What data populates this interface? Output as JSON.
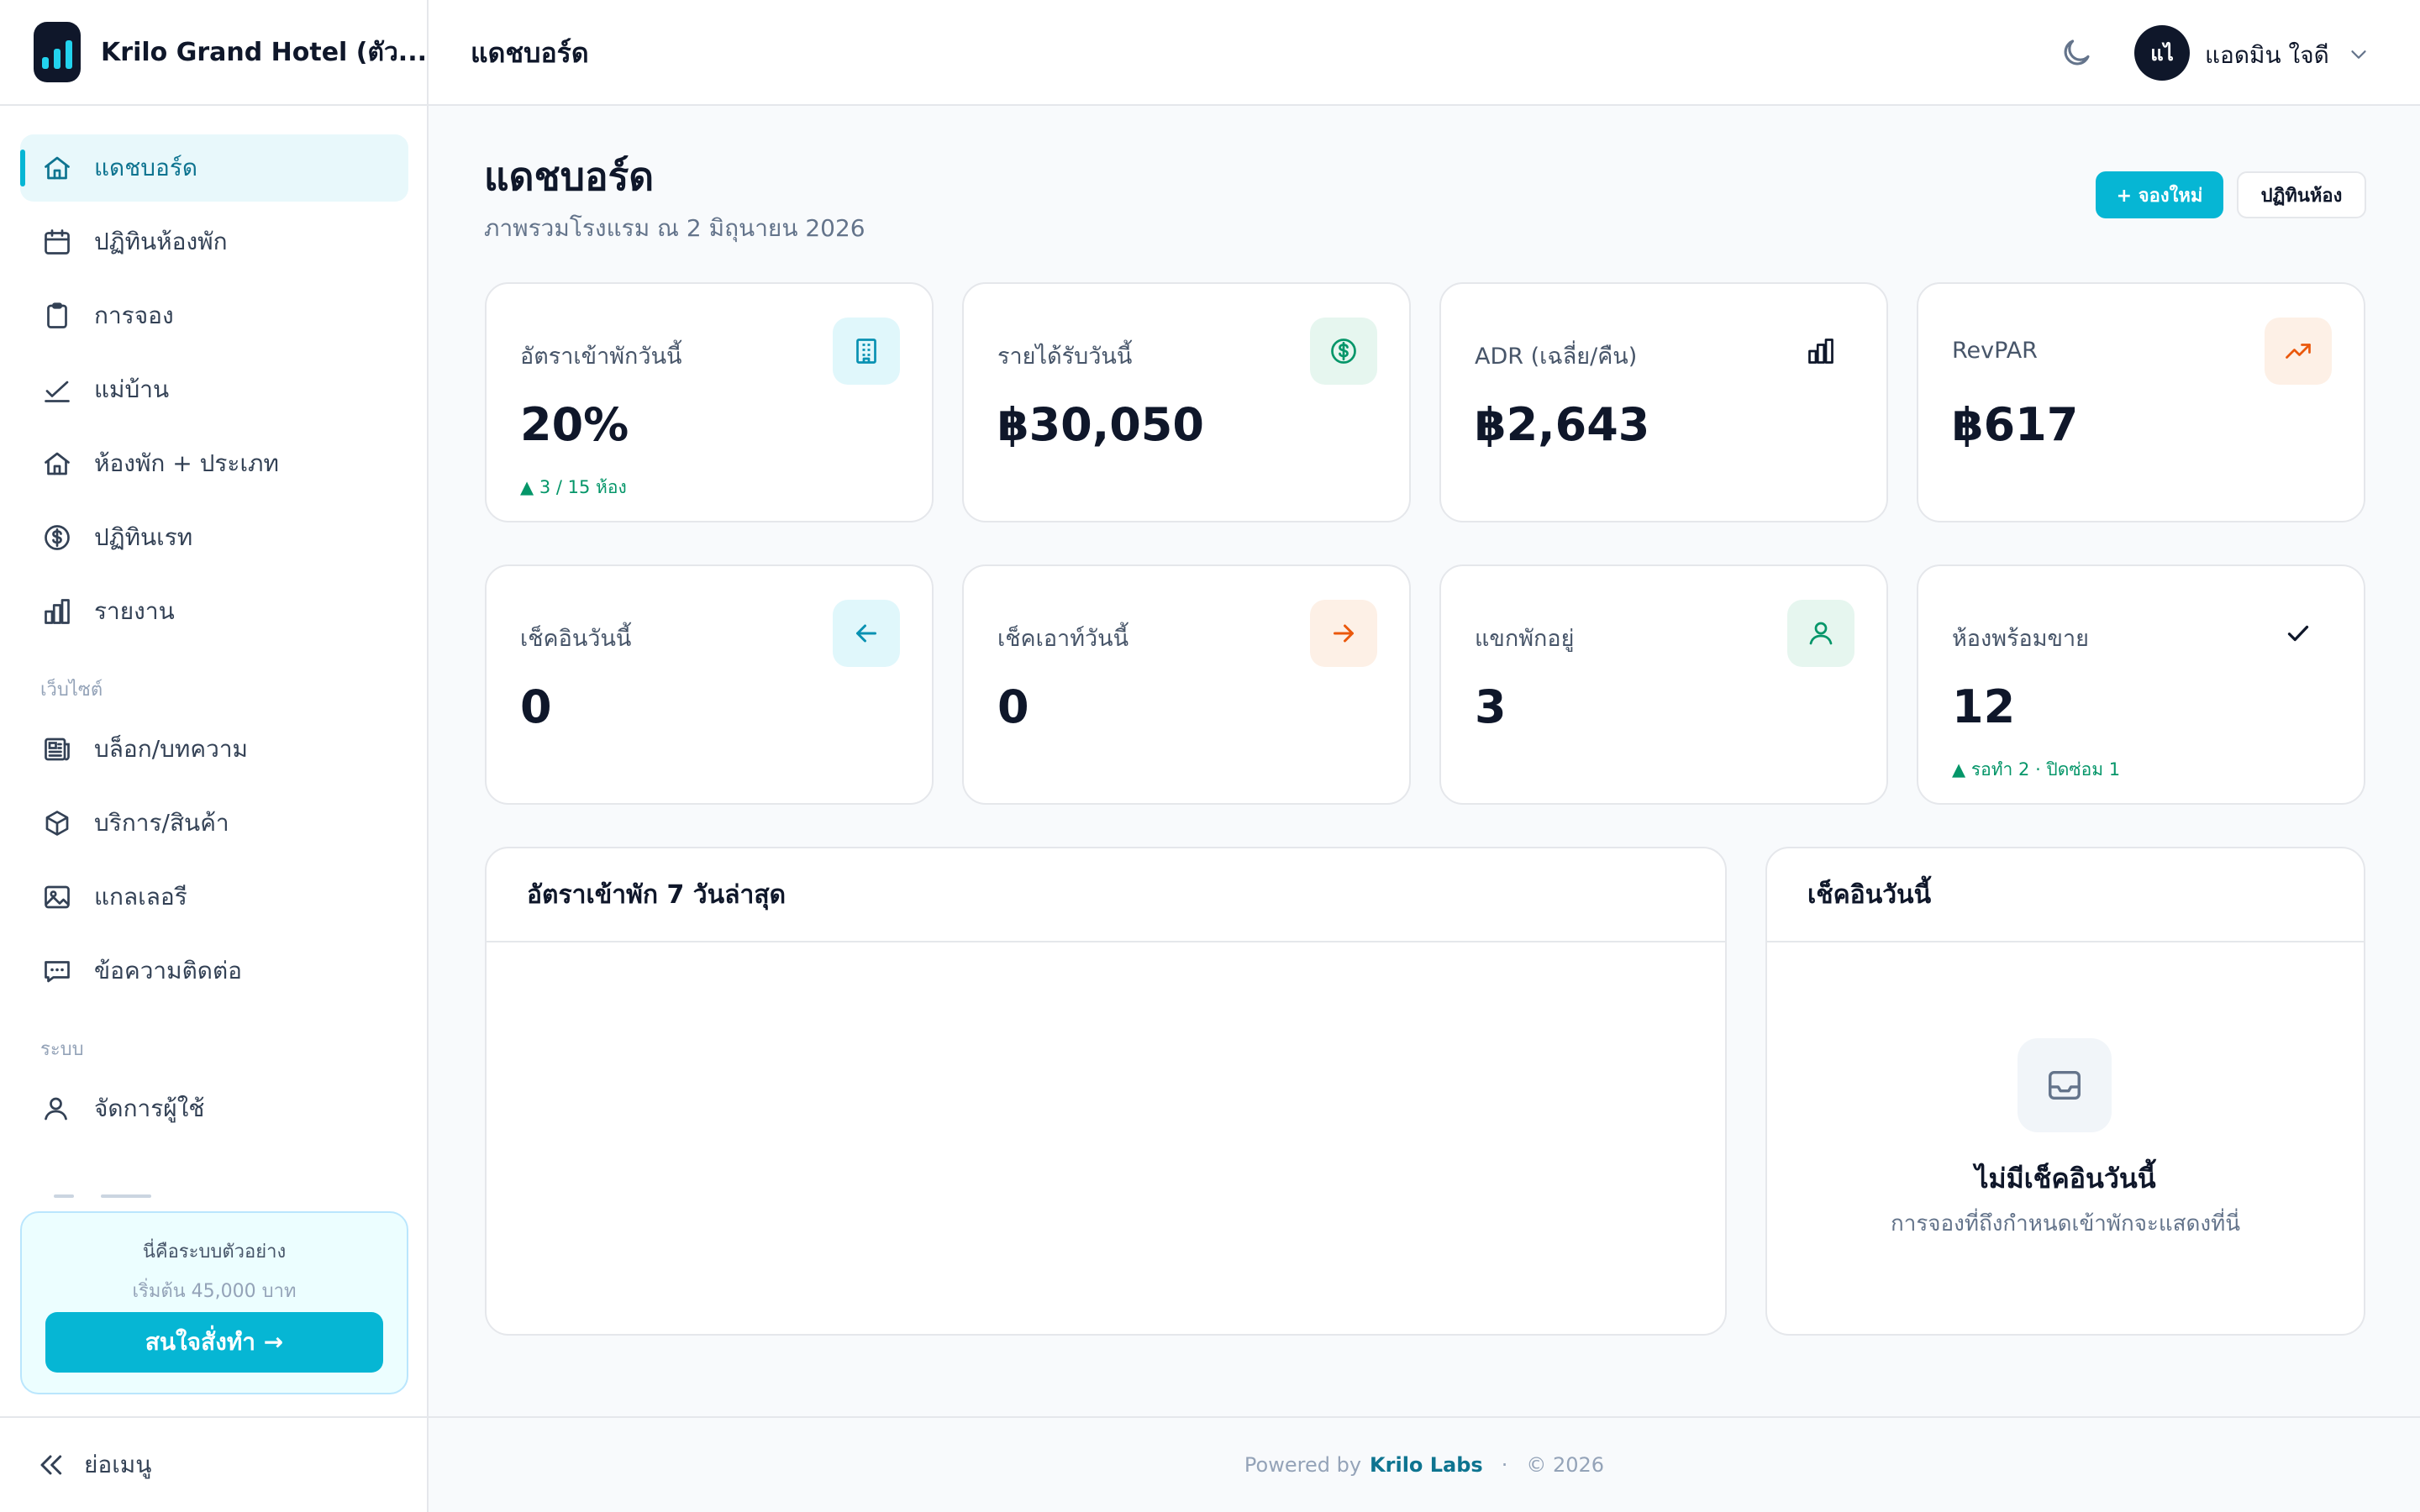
{
  "app": {
    "name": "Krilo Grand Hotel (ตัว..."
  },
  "sidebar": {
    "main_items": [
      {
        "label": "แดชบอร์ด",
        "icon": "home-icon"
      },
      {
        "label": "ปฏิทินห้องพัก",
        "icon": "calendar-icon"
      },
      {
        "label": "การจอง",
        "icon": "clipboard-icon"
      },
      {
        "label": "แม่บ้าน",
        "icon": "check-icon"
      },
      {
        "label": "ห้องพัก + ประเภท",
        "icon": "home-icon"
      },
      {
        "label": "ปฏิทินเรท",
        "icon": "dollar-icon"
      },
      {
        "label": "รายงาน",
        "icon": "bar-chart-icon"
      }
    ],
    "website_section": "เว็บไซต์",
    "website_items": [
      {
        "label": "บล็อก/บทความ",
        "icon": "newspaper-icon"
      },
      {
        "label": "บริการ/สินค้า",
        "icon": "box-icon"
      },
      {
        "label": "แกลเลอรี",
        "icon": "image-icon"
      },
      {
        "label": "ข้อความติดต่อ",
        "icon": "message-icon"
      }
    ],
    "system_section": "ระบบ",
    "system_items": [
      {
        "label": "จัดการผู้ใช้",
        "icon": "users-icon"
      }
    ],
    "promo": {
      "title": "นี่คือระบบตัวอย่าง",
      "subtitle": "เริ่มต้น 45,000 บาท",
      "button": "สนใจสั่งทำ →"
    },
    "collapse_label": "ย่อเมนู"
  },
  "topbar": {
    "title": "แดชบอร์ด",
    "avatar_initials": "แไ",
    "user_name": "แอดมิน ใจดี"
  },
  "page": {
    "title": "แดชบอร์ด",
    "subtitle": "ภาพรวมโรงแรม ณ 2 มิถุนายน 2026",
    "new_booking": "+ จองใหม่",
    "room_calendar": "ปฏิทินห้อง"
  },
  "stats": [
    {
      "label": "อัตราเข้าพักวันนี้",
      "value": "20%",
      "note": "▲ 3 / 15 ห้อง",
      "icon": "building-icon",
      "icon_color": "#0891b2",
      "icon_bg": "#e0f7fb"
    },
    {
      "label": "รายได้รับวันนี้",
      "value": "฿30,050",
      "note": "",
      "icon": "dollar-icon",
      "icon_color": "#059669",
      "icon_bg": "#e6f6ef"
    },
    {
      "label": "ADR (เฉลี่ย/คืน)",
      "value": "฿2,643",
      "note": "",
      "icon": "bar-chart-icon",
      "icon_color": "#0f172a",
      "icon_bg": "transparent"
    },
    {
      "label": "RevPAR",
      "value": "฿617",
      "note": "",
      "icon": "trending-up-icon",
      "icon_color": "#ea580c",
      "icon_bg": "#fdf0e6"
    },
    {
      "label": "เช็คอินวันนี้",
      "value": "0",
      "note": "",
      "icon": "arrow-left-icon",
      "icon_color": "#0891b2",
      "icon_bg": "#e0f7fb"
    },
    {
      "label": "เช็คเอาท์วันนี้",
      "value": "0",
      "note": "",
      "icon": "arrow-right-icon",
      "icon_color": "#ea580c",
      "icon_bg": "#fdf0e6"
    },
    {
      "label": "แขกพักอยู่",
      "value": "3",
      "note": "",
      "icon": "user-icon",
      "icon_color": "#059669",
      "icon_bg": "#e6f6ef"
    },
    {
      "label": "ห้องพร้อมขาย",
      "value": "12",
      "note": "▲ รอทำ 2 · ปิดซ่อม 1",
      "icon": "check-icon",
      "icon_color": "#0f172a",
      "icon_bg": "transparent"
    }
  ],
  "occupancy_panel": {
    "title": "อัตราเข้าพัก 7 วันล่าสุด"
  },
  "checkin_panel": {
    "title": "เช็คอินวันนี้",
    "empty_title": "ไม่มีเช็คอินวันนี้",
    "empty_subtitle": "การจองที่ถึงกำหนดเข้าพักจะแสดงที่นี่"
  },
  "footer": {
    "powered_by": "Powered by",
    "brand": "Krilo Labs",
    "separator": "·",
    "copyright": "© 2026"
  },
  "colors": {
    "accent": "#06b6d4",
    "accent_dark": "#0e7490",
    "positive": "#059669"
  }
}
